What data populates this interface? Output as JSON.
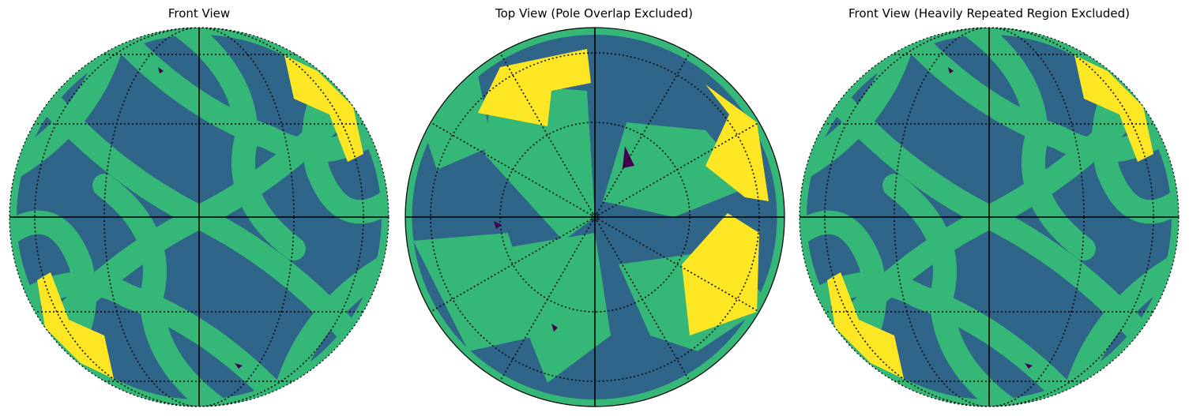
{
  "figure": {
    "panels": [
      {
        "title": "Front View",
        "view": "front"
      },
      {
        "title": "Top View (Pole Overlap Excluded)",
        "view": "top"
      },
      {
        "title": "Front View (Heavily Repeated Region Excluded)",
        "view": "front"
      }
    ],
    "palette": {
      "background_region": "#2e6588",
      "band_region": "#35b778",
      "bright_region": "#fde725",
      "dark_spot": "#440154",
      "grid_line": "#000000"
    }
  }
}
